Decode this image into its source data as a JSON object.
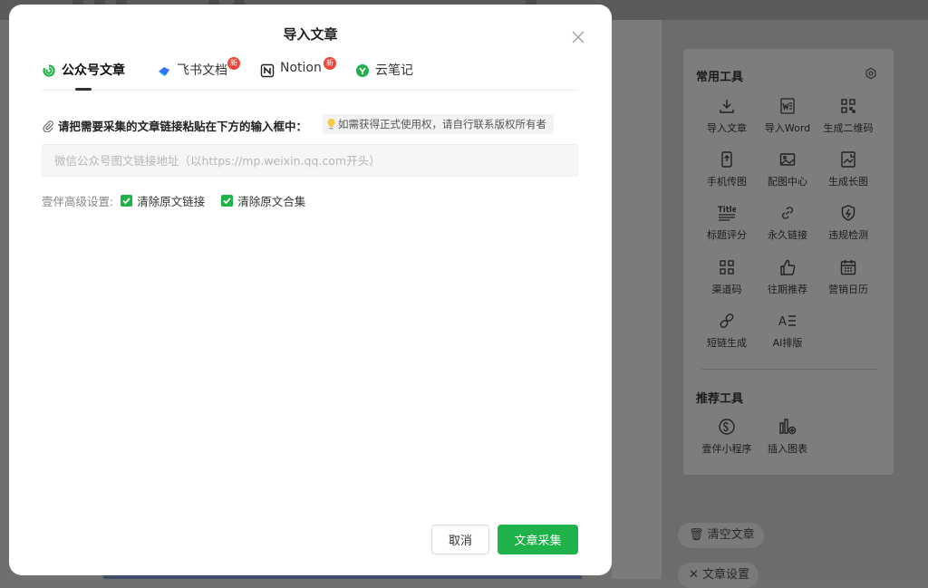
{
  "colors": {
    "accent": "#1fb14a",
    "badge": "#f0453a",
    "overlay": "#6f6f6f"
  },
  "modal": {
    "title": "导入文章",
    "tabs": [
      {
        "label": "公众号文章",
        "icon": "wechat-icon",
        "active": true,
        "badge": ""
      },
      {
        "label": "飞书文档",
        "icon": "feishu-icon",
        "active": false,
        "badge": "新"
      },
      {
        "label": "Notion",
        "icon": "notion-icon",
        "active": false,
        "badge": "新"
      },
      {
        "label": "云笔记",
        "icon": "youdao-note-icon",
        "active": false,
        "badge": ""
      }
    ],
    "instruction": "请把需要采集的文章链接粘贴在下方的输入框中：",
    "hint": "如需获得正式使用权，请自行联系版权所有者",
    "url_input": {
      "value": "",
      "placeholder": "微信公众号图文链接地址（以https://mp.weixin.qq.com开头）"
    },
    "advanced": {
      "label": "壹伴高级设置:",
      "options": [
        {
          "label": "清除原文链接",
          "checked": true
        },
        {
          "label": "清除原文合集",
          "checked": true
        }
      ]
    },
    "buttons": {
      "cancel": "取消",
      "confirm": "文章采集"
    }
  },
  "background": {
    "common_tools": {
      "title": "常用工具",
      "items": [
        {
          "label": "导入文章",
          "icon": "import-article-icon"
        },
        {
          "label": "导入Word",
          "icon": "word-icon"
        },
        {
          "label": "生成二维码",
          "icon": "qrcode-icon"
        },
        {
          "label": "手机传图",
          "icon": "phone-upload-icon"
        },
        {
          "label": "配图中心",
          "icon": "image-center-icon"
        },
        {
          "label": "生成长图",
          "icon": "long-image-icon"
        },
        {
          "label": "标题评分",
          "icon": "title-score-icon"
        },
        {
          "label": "永久链接",
          "icon": "permalink-icon"
        },
        {
          "label": "违规检测",
          "icon": "violation-check-icon"
        },
        {
          "label": "渠道码",
          "icon": "channel-code-icon"
        },
        {
          "label": "往期推荐",
          "icon": "thumbs-up-icon"
        },
        {
          "label": "营销日历",
          "icon": "calendar-icon"
        },
        {
          "label": "短链生成",
          "icon": "short-link-icon"
        },
        {
          "label": "AI排版",
          "icon": "ai-layout-icon"
        }
      ]
    },
    "recommended_tools": {
      "title": "推荐工具",
      "items": [
        {
          "label": "壹伴小程序",
          "icon": "mini-program-icon"
        },
        {
          "label": "插入图表",
          "icon": "insert-chart-icon"
        }
      ]
    },
    "clear_article": "清空文章",
    "article_settings": "文章设置"
  }
}
